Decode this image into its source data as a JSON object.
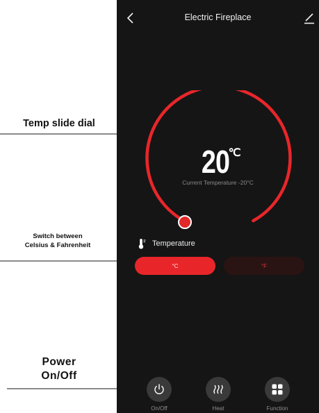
{
  "header": {
    "back_icon": "chevron-left-icon",
    "title": "Electric Fireplace",
    "edit_icon": "pencil-icon"
  },
  "dial": {
    "temperature_value": "20",
    "temperature_unit": "℃",
    "current_temperature_text": "Current Temperature -20°C",
    "accent_color": "#e8262a"
  },
  "temperature_setting": {
    "label": "Temperature",
    "icon": "thermometer-icon",
    "options": [
      "°C",
      "°F"
    ],
    "selected": "°C"
  },
  "bottom_bar": {
    "items": [
      {
        "label": "On/Off",
        "icon": "power-icon"
      },
      {
        "label": "Heat",
        "icon": "heat-waves-icon"
      },
      {
        "label": "Function",
        "icon": "grid-icon"
      }
    ]
  },
  "annotations": {
    "dial_label": "Temp slide dial",
    "unit_switch_label_line1": "Switch between",
    "unit_switch_label_line2": "Celsius & Fahrenheit",
    "power_label_line1": "Power",
    "power_label_line2": "On/Off"
  }
}
